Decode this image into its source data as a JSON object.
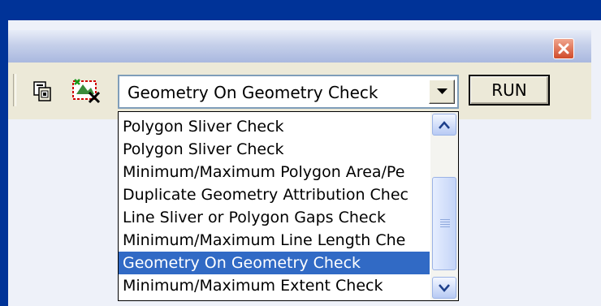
{
  "toolbar": {
    "copy_icon": "clipboard-copy-icon",
    "clear_icon": "clear-selection-icon",
    "combo_value": "Geometry On Geometry Check",
    "run_label": "RUN"
  },
  "dropdown": {
    "items": [
      "Polygon Sliver Check",
      "Polygon Sliver Check",
      "Minimum/Maximum Polygon Area/Pe",
      "Duplicate Geometry Attribution Chec",
      "Line Sliver or Polygon Gaps Check",
      "Minimum/Maximum Line Length Che",
      "Geometry On Geometry Check",
      "Minimum/Maximum Extent Check"
    ],
    "selected_index": 6
  },
  "colors": {
    "selection": "#316ac5",
    "window_frame": "#003398",
    "close_button": "#d04a2a"
  }
}
